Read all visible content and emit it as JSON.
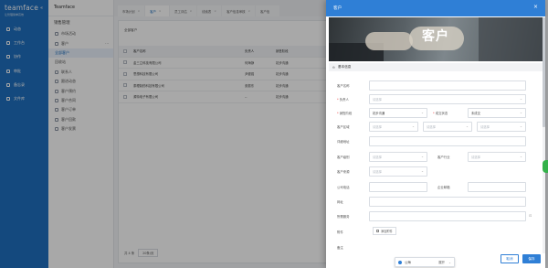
{
  "app": {
    "logo": "teamface",
    "logo_sub": "让管理简单高效"
  },
  "nav": {
    "items": [
      {
        "label": "动态"
      },
      {
        "label": "工作台"
      },
      {
        "label": "协作"
      },
      {
        "label": "审批"
      },
      {
        "label": "备忘录"
      },
      {
        "label": "文件库"
      }
    ]
  },
  "module": {
    "name": "Teamface",
    "title": "销售管理",
    "items": [
      {
        "label": "市场活动"
      },
      {
        "label": "客户"
      },
      {
        "label": "全部客户"
      },
      {
        "label": "回收站"
      },
      {
        "label": "联系人"
      },
      {
        "label": "跟进动态"
      },
      {
        "label": "客户预约"
      },
      {
        "label": "客户合同"
      },
      {
        "label": "客户订单"
      },
      {
        "label": "客户回款"
      },
      {
        "label": "客户发票"
      }
    ]
  },
  "tabs": [
    {
      "label": "市场计划"
    },
    {
      "label": "客户"
    },
    {
      "label": "员工评估"
    },
    {
      "label": "线索表"
    },
    {
      "label": "客户信息审核"
    },
    {
      "label": "客户信"
    }
  ],
  "list": {
    "breadcrumb": "全部客户",
    "columns": [
      "客户名称",
      "负责人",
      "销售阶段"
    ],
    "rows": [
      {
        "name": "金三立科技有限公司",
        "owner": "何海静",
        "stage": "初步沟通"
      },
      {
        "name": "思想科技有限公司",
        "owner": "尹健强",
        "stage": "初步沟通"
      },
      {
        "name": "泰理制药科技有限公司",
        "owner": "张振东",
        "stage": "初步沟通"
      },
      {
        "name": "源特电子有限公司",
        "owner": "--",
        "stage": "初步沟通"
      }
    ],
    "pager_total": "共 4 条",
    "pager_size": "20条/页"
  },
  "drawer": {
    "title": "客户",
    "banner_text": "客户",
    "section": "基本信息",
    "fields": {
      "name_label": "客户名称",
      "owner_label": "负责人",
      "owner_placeholder": "请选择",
      "stage_label": "销售阶段",
      "stage_value": "初步沟通",
      "deal_label": "成交状态",
      "deal_value": "未成交",
      "region_label": "客户区域",
      "region_placeholder_1": "请选择",
      "region_placeholder_2": "请选择",
      "region_placeholder_3": "请选择",
      "address_label": "详细地址",
      "level_label": "客户级别",
      "level_placeholder": "请选择",
      "industry_label": "客户行业",
      "industry_placeholder": "请选择",
      "source_label": "客户来源",
      "source_placeholder": "请选择",
      "phone_label": "公司电话",
      "email_label": "企业邮箱",
      "website_label": "网址",
      "note_label": "所需服务",
      "attach_label": "附件",
      "attach_button": "添加附件",
      "remark_label": "备注"
    },
    "popup_label": "公海",
    "popup_right": "展开",
    "cancel": "取消",
    "save": "保存"
  },
  "colors": {
    "nav": "#1f6fbf",
    "accent": "#2f7fd6"
  }
}
